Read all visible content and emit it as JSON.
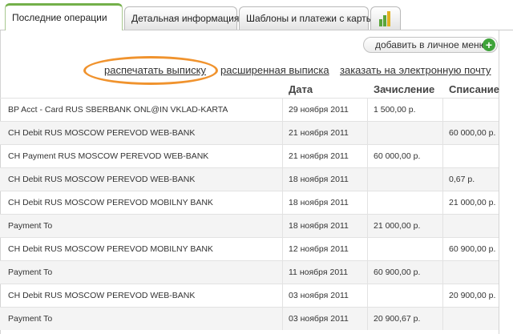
{
  "tabs": [
    {
      "label": "Последние операции",
      "active": true
    },
    {
      "label": "Детальная информация",
      "active": false
    },
    {
      "label": "Шаблоны и платежи с карты",
      "active": false
    }
  ],
  "tab_icon": "bar-chart-icon",
  "add_button": {
    "label": "добавить в личное меню",
    "icon": "plus-circle-icon"
  },
  "links": {
    "print": "распечатать выписку",
    "extended": "расширенная выписка",
    "order_email": "заказать на электронную почту"
  },
  "columns": {
    "date": "Дата",
    "credit": "Зачисление",
    "debit": "Списание"
  },
  "colors": {
    "accent_green": "#74b04a",
    "highlight_orange": "#f0932e"
  },
  "transactions": [
    {
      "desc": "BP Acct - Card RUS SBERBANK ONL@IN VKLAD-KARTA",
      "date": "29 ноября 2011",
      "credit": "1 500,00 р.",
      "debit": ""
    },
    {
      "desc": "CH Debit RUS MOSCOW PEREVOD WEB-BANK",
      "date": "21 ноября 2011",
      "credit": "",
      "debit": "60 000,00 р."
    },
    {
      "desc": "CH Payment RUS MOSCOW PEREVOD WEB-BANK",
      "date": "21 ноября 2011",
      "credit": "60 000,00 р.",
      "debit": ""
    },
    {
      "desc": "CH Debit RUS MOSCOW PEREVOD WEB-BANK",
      "date": "18 ноября 2011",
      "credit": "",
      "debit": "0,67 р."
    },
    {
      "desc": "CH Debit RUS MOSCOW PEREVOD MOBILNY BANK",
      "date": "18 ноября 2011",
      "credit": "",
      "debit": "21 000,00 р."
    },
    {
      "desc": "Payment To",
      "date": "18 ноября 2011",
      "credit": "21 000,00 р.",
      "debit": ""
    },
    {
      "desc": "CH Debit RUS MOSCOW PEREVOD MOBILNY BANK",
      "date": "12 ноября 2011",
      "credit": "",
      "debit": "60 900,00 р."
    },
    {
      "desc": "Payment To",
      "date": "11 ноября 2011",
      "credit": "60 900,00 р.",
      "debit": ""
    },
    {
      "desc": "CH Debit RUS MOSCOW PEREVOD WEB-BANK",
      "date": "03 ноября 2011",
      "credit": "",
      "debit": "20 900,00 р."
    },
    {
      "desc": "Payment To",
      "date": "03 ноября 2011",
      "credit": "20 900,67 р.",
      "debit": ""
    }
  ]
}
